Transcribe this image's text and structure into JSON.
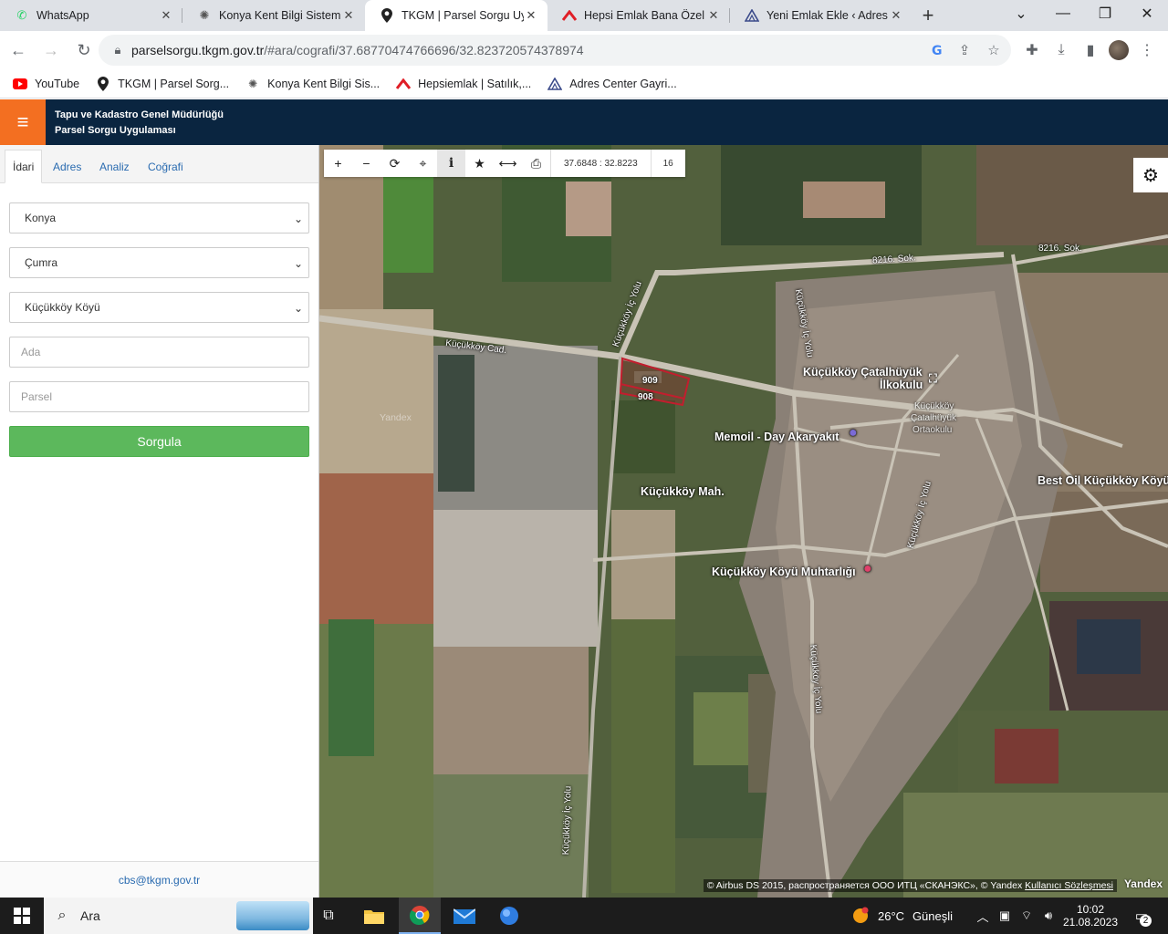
{
  "browser": {
    "tabs": [
      {
        "label": "WhatsApp",
        "icon": "whatsapp-icon",
        "active": false
      },
      {
        "label": "Konya Kent Bilgi Sistemi",
        "icon": "konya-logo-icon",
        "active": false
      },
      {
        "label": "TKGM | Parsel Sorgu Uyg",
        "icon": "map-pin-icon",
        "active": true
      },
      {
        "label": "Hepsi Emlak Bana Özel",
        "icon": "hepsiemlak-icon",
        "active": false
      },
      {
        "label": "Yeni Emlak Ekle ‹ Adres Ce",
        "icon": "adres-center-icon",
        "active": false
      }
    ],
    "url_host": "parselsorgu.tkgm.gov.tr",
    "url_path": "/#ara/cografi/37.68770474766696/32.823720574378974",
    "bookmarks": [
      {
        "label": "YouTube",
        "icon": "youtube-icon"
      },
      {
        "label": "TKGM | Parsel Sorg...",
        "icon": "map-pin-icon"
      },
      {
        "label": "Konya Kent Bilgi Sis...",
        "icon": "konya-logo-icon"
      },
      {
        "label": "Hepsiemlak | Satılık,...",
        "icon": "hepsiemlak-icon"
      },
      {
        "label": "Adres Center Gayri...",
        "icon": "adres-center-icon"
      }
    ]
  },
  "app": {
    "title_line1": "Tapu ve Kadastro Genel Müdürlüğü",
    "title_line2": "Parsel Sorgu Uygulaması",
    "accent_color": "#f36f21",
    "header_color": "#0a2540"
  },
  "sidebar": {
    "tabs": [
      "İdari",
      "Adres",
      "Analiz",
      "Coğrafi"
    ],
    "il": "Konya",
    "ilce": "Çumra",
    "mahalle": "Küçükköy Köyü",
    "ada_placeholder": "Ada",
    "parsel_placeholder": "Parsel",
    "submit_label": "Sorgula",
    "footer_email": "cbs@tkgm.gov.tr"
  },
  "map": {
    "coordinates": "37.6848 : 32.8223",
    "zoom": "16",
    "parcels": [
      "909",
      "908"
    ],
    "labels": {
      "village": "Küçükköy Mah.",
      "school_1": "Küçükköy Çatalhüyük",
      "school_2": "İlkokulu",
      "school_faded_1": "Küçükköy",
      "school_faded_2": "Çatalhüyük",
      "school_faded_3": "Ortaokulu",
      "fuel": "Memoil - Day Akaryakıt",
      "best_oil": "Best Oil Küçükköy Köyü",
      "muhtarlik": "Küçükköy Köyü Muhtarlığı",
      "road_cad": "Küçükköy Cad.",
      "road_ic_1": "Küçükköy İç Yolu",
      "road_ic_2": "Küçükköy İç Yolu",
      "road_ic_3": "Küçükköy İç Yolu",
      "road_ic_4": "Küçükköy İç Yolu",
      "road_ic_5": "Küçükköy İç Yolu",
      "road_8216": "8216. Sok.",
      "road_8216_b": "8216. Sok.",
      "watermark": "Yandex"
    },
    "attribution_text": "© Airbus DS 2015, распространяется ООО ИТЦ «СКАНЭКС», © Yandex",
    "attribution_link": "Kullanıcı Sözleşmesi",
    "brand": "Yandex"
  },
  "taskbar": {
    "search_placeholder": "Ara",
    "weather_temp": "26°C",
    "weather_text": "Güneşli",
    "time": "10:02",
    "date": "21.08.2023",
    "notification_count": "2"
  }
}
